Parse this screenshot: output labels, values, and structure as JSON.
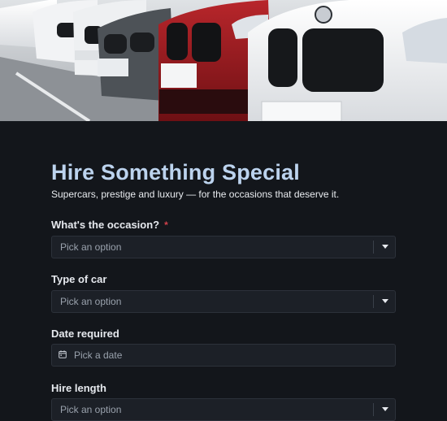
{
  "form": {
    "title": "Hire Something Special",
    "subtitle": "Supercars, prestige and luxury — for the occasions that deserve it.",
    "fields": [
      {
        "label": "What's the occasion?",
        "required_mark": "*",
        "placeholder": "Pick an option",
        "icon": "chevron-down-icon"
      },
      {
        "label": "Type of car",
        "placeholder": "Pick an option",
        "icon": "chevron-down-icon"
      },
      {
        "label": "Date required",
        "placeholder": "Pick a date",
        "icon": "calendar-icon"
      },
      {
        "label": "Hire length",
        "placeholder": "Pick an option",
        "icon": "chevron-down-icon"
      }
    ]
  },
  "colors": {
    "background": "#13161b",
    "title": "#bcd3ee",
    "field_bg": "#1c2027",
    "required": "#d3414b"
  }
}
